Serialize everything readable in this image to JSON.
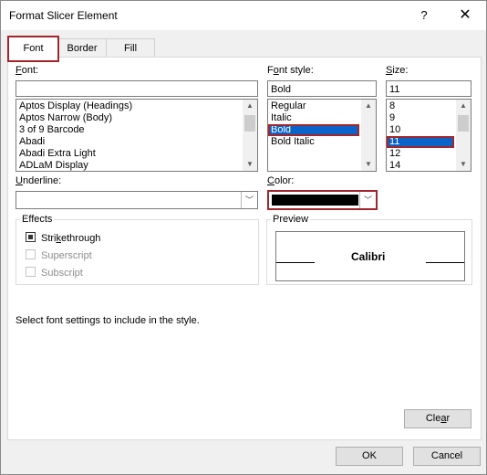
{
  "window": {
    "title": "Format Slicer Element",
    "help_glyph": "?",
    "close_glyph": "✕"
  },
  "tabs": [
    {
      "label": "Font",
      "active": true
    },
    {
      "label": "Border",
      "active": false
    },
    {
      "label": "Fill",
      "active": false
    }
  ],
  "font": {
    "label": "Font:",
    "value": "",
    "list": [
      "Aptos Display (Headings)",
      "Aptos Narrow (Body)",
      "3 of 9 Barcode",
      "Abadi",
      "Abadi Extra Light",
      "ADLaM Display"
    ]
  },
  "font_style": {
    "label": "Font style:",
    "value": "Bold",
    "list": [
      "Regular",
      "Italic",
      "Bold",
      "Bold Italic"
    ],
    "selected": "Bold"
  },
  "size": {
    "label": "Size:",
    "value": "11",
    "list": [
      "8",
      "9",
      "10",
      "11",
      "12",
      "14"
    ],
    "selected": "11"
  },
  "underline": {
    "label": "Underline:",
    "value": ""
  },
  "color": {
    "label": "Color:",
    "value_hex": "#000000"
  },
  "effects": {
    "label": "Effects",
    "items": [
      {
        "label": "Strikethrough",
        "checked": true,
        "enabled": true
      },
      {
        "label": "Superscript",
        "checked": false,
        "enabled": false
      },
      {
        "label": "Subscript",
        "checked": false,
        "enabled": false
      }
    ]
  },
  "preview": {
    "label": "Preview",
    "sample_text": "Calibri"
  },
  "hint": "Select font settings to include in the style.",
  "buttons": {
    "clear": "Clear",
    "ok": "OK",
    "cancel": "Cancel"
  },
  "colors": {
    "accent_outline": "#a1262b",
    "selection": "#0a64c8"
  }
}
